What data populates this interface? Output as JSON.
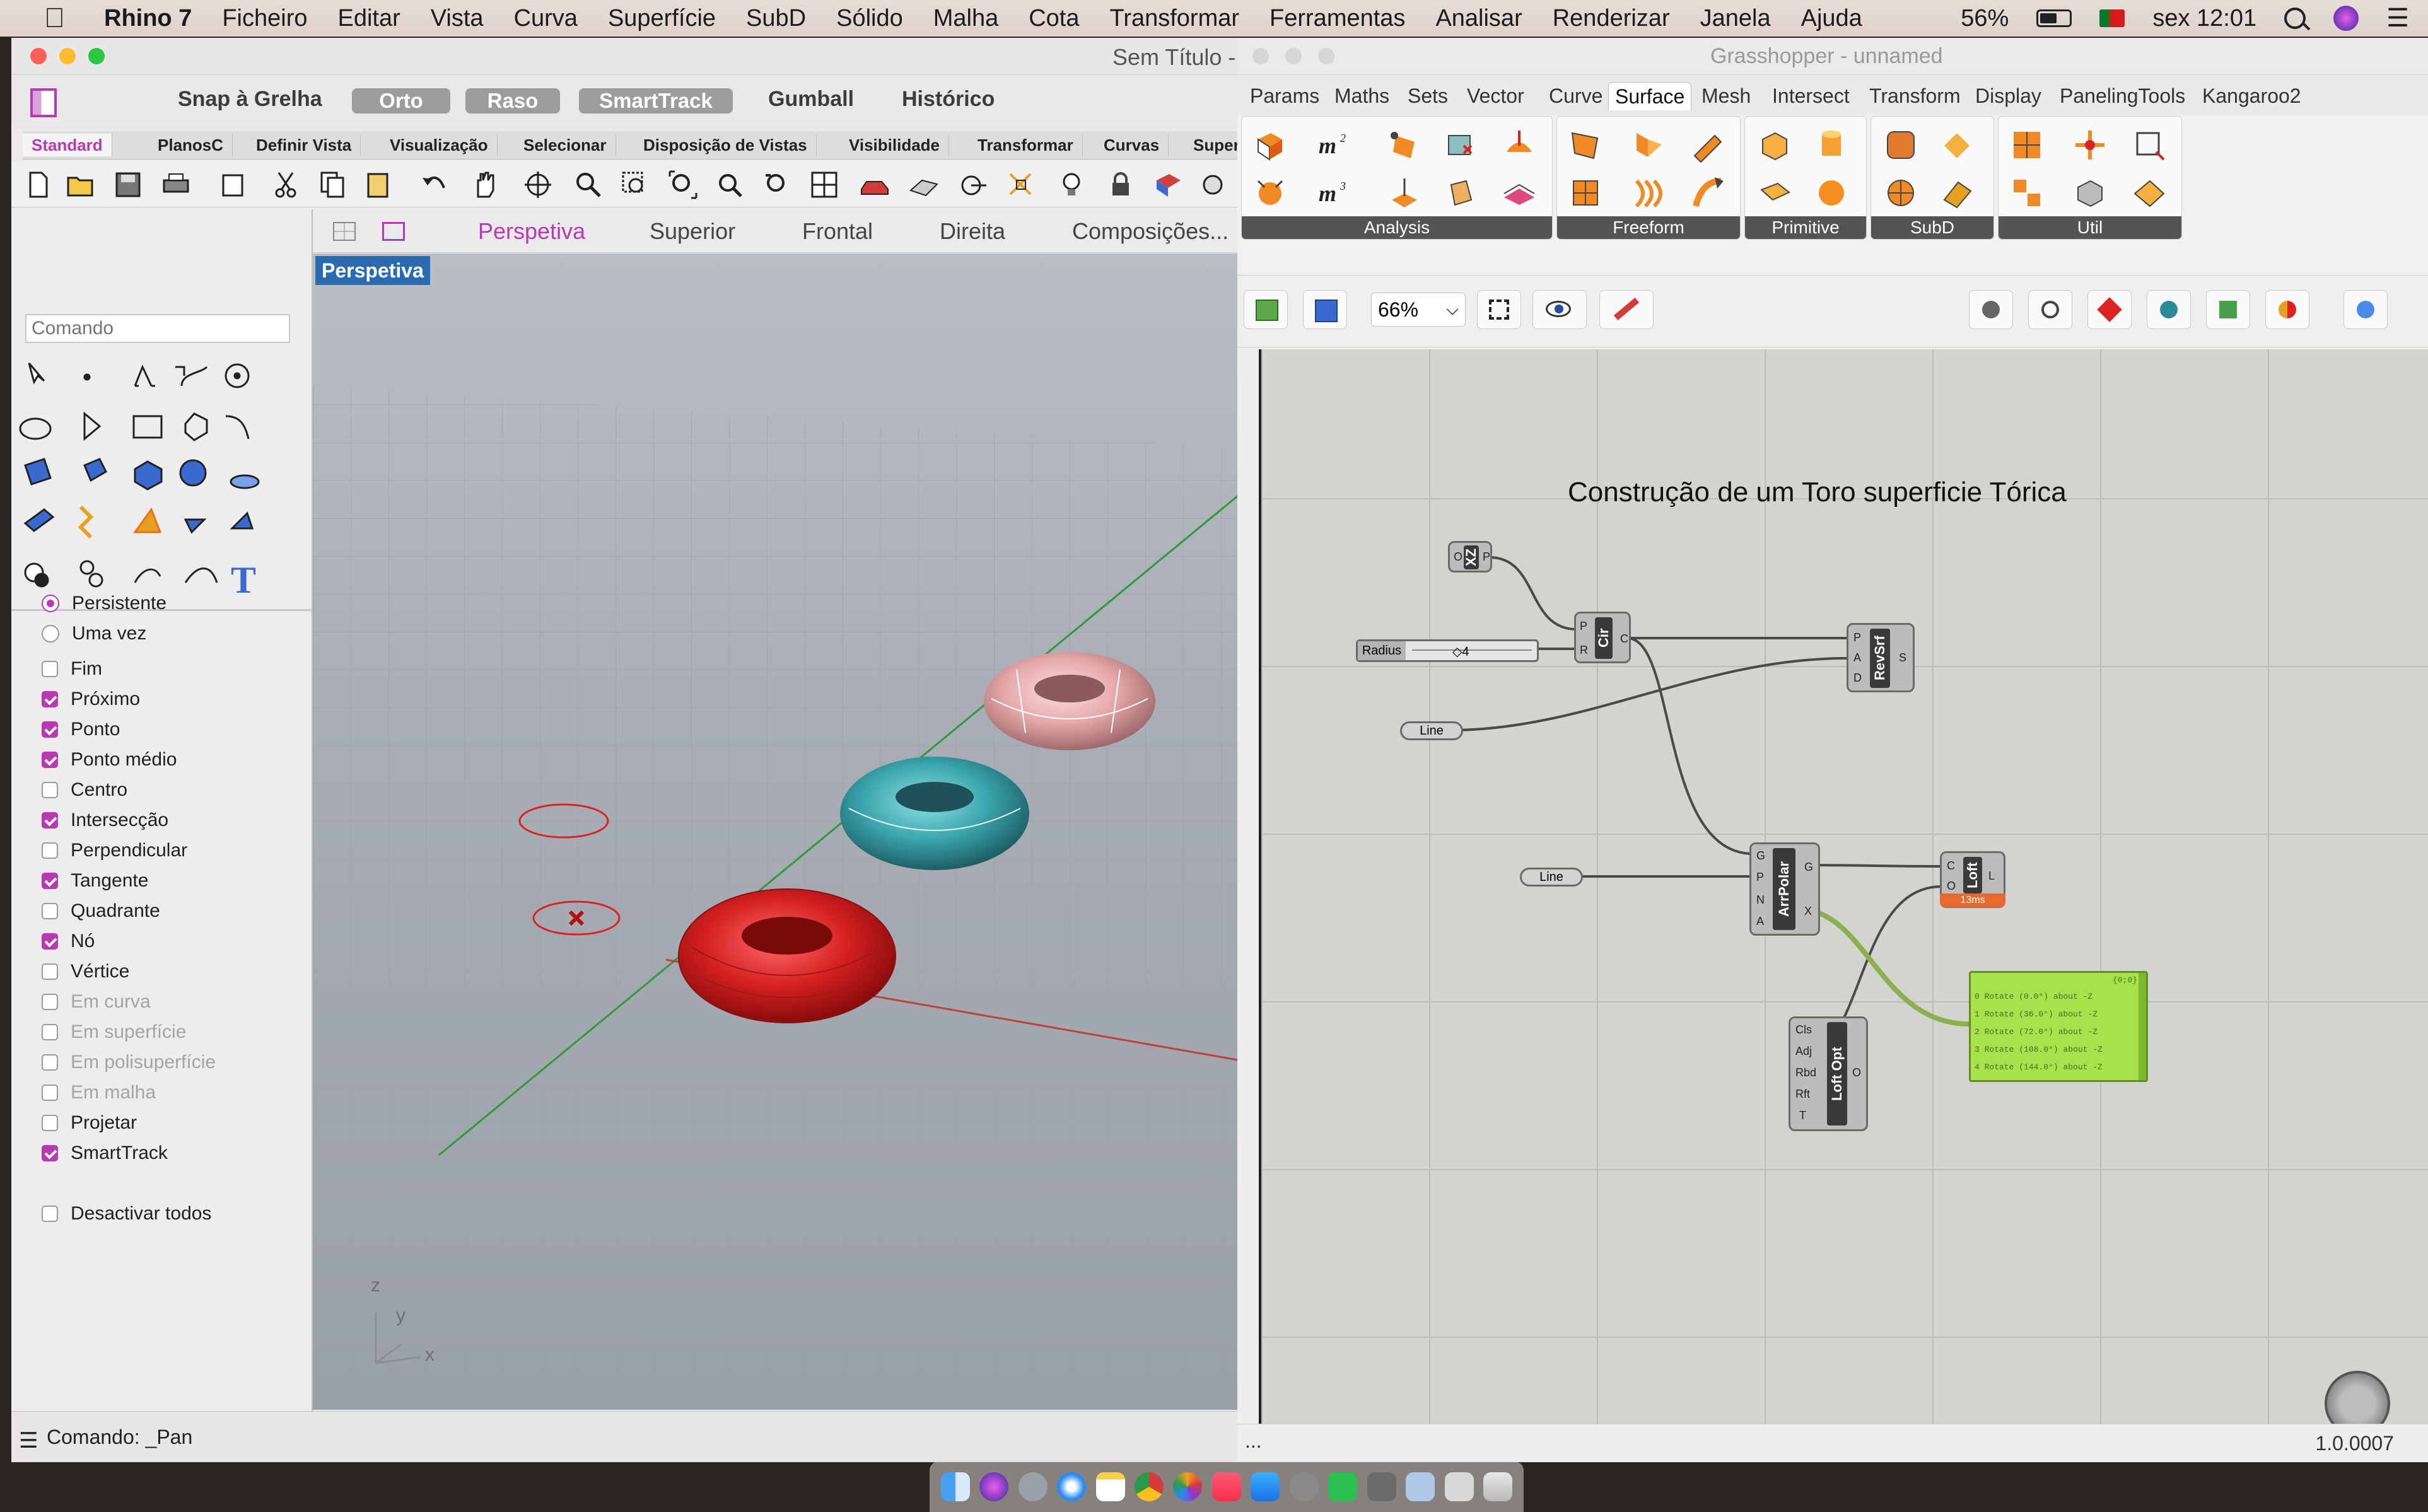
{
  "menubar": {
    "app": "Rhino 7",
    "items": [
      "Ficheiro",
      "Editar",
      "Vista",
      "Curva",
      "Superfície",
      "SubD",
      "Sólido",
      "Malha",
      "Cota",
      "Transformar",
      "Ferramentas",
      "Analisar",
      "Renderizar",
      "Janela",
      "Ajuda"
    ],
    "battery": "56%",
    "clock": "sex 12:01"
  },
  "rhino": {
    "title": "Sem Título -",
    "toolbar": {
      "snap": "Snap à Grelha",
      "ortho": "Orto",
      "planar": "Raso",
      "smarttrack": "SmartTrack",
      "gumball": "Gumball",
      "history": "Histórico"
    },
    "tabs": [
      "Standard",
      "PlanosC",
      "Definir Vista",
      "Visualização",
      "Selecionar",
      "Disposição de Vistas",
      "Visibilidade",
      "Transformar",
      "Curvas",
      "Superf"
    ],
    "command_placeholder": "Comando",
    "viewtabs": [
      "Perspetiva",
      "Superior",
      "Frontal",
      "Direita",
      "Composições..."
    ],
    "viewport_label": "Perspetiva",
    "axis": {
      "z": "z",
      "y": "y",
      "x": "x"
    },
    "osnap": [
      {
        "label": "Persistente",
        "type": "radio",
        "checked": true
      },
      {
        "label": "Uma vez",
        "type": "radio",
        "checked": false
      },
      {
        "label": "Fim",
        "checked": false
      },
      {
        "label": "Próximo",
        "checked": true
      },
      {
        "label": "Ponto",
        "checked": true
      },
      {
        "label": "Ponto médio",
        "checked": true
      },
      {
        "label": "Centro",
        "checked": false
      },
      {
        "label": "Intersecção",
        "checked": true
      },
      {
        "label": "Perpendicular",
        "checked": false
      },
      {
        "label": "Tangente",
        "checked": true
      },
      {
        "label": "Quadrante",
        "checked": false
      },
      {
        "label": "Nó",
        "checked": true
      },
      {
        "label": "Vértice",
        "checked": false
      },
      {
        "label": "Em curva",
        "checked": false,
        "disabled": true
      },
      {
        "label": "Em superfície",
        "checked": false,
        "disabled": true
      },
      {
        "label": "Em polisuperfície",
        "checked": false,
        "disabled": true
      },
      {
        "label": "Em malha",
        "checked": false,
        "disabled": true
      },
      {
        "label": "Projetar",
        "checked": false
      },
      {
        "label": "SmartTrack",
        "checked": true
      },
      {
        "label": "Desactivar todos",
        "checked": false
      }
    ],
    "status": "Comando: _Pan"
  },
  "grasshopper": {
    "title": "Grasshopper - unnamed",
    "menu": [
      "Params",
      "Maths",
      "Sets",
      "Vector",
      "Curve",
      "Surface",
      "Mesh",
      "Intersect",
      "Transform",
      "Display",
      "PanelingTools",
      "Kangaroo2"
    ],
    "active_menu": "Surface",
    "panels": [
      "Analysis",
      "Freeform",
      "Primitive",
      "SubD",
      "Util"
    ],
    "zoom": "66%",
    "canvas_title": "Construção de um Toro superficie Tórica",
    "nodes": {
      "xz": {
        "label": "XZ",
        "in": "O",
        "out": "P"
      },
      "slider": {
        "label": "Radius",
        "value": "◇4"
      },
      "circle": {
        "label": "Cir",
        "in": [
          "P",
          "R"
        ],
        "out": "C"
      },
      "line1": {
        "label": "Line"
      },
      "revsrf": {
        "label": "RevSrf",
        "in": [
          "P",
          "A",
          "D"
        ],
        "out": "S"
      },
      "line2": {
        "label": "Line"
      },
      "arrpolar": {
        "label": "ArrPolar",
        "in": [
          "G",
          "P",
          "N",
          "A"
        ],
        "out": [
          "G",
          "X"
        ]
      },
      "loft": {
        "label": "Loft",
        "in": [
          "C",
          "O"
        ],
        "out": "L",
        "time": "13ms"
      },
      "loftopt": {
        "label": "Loft Opt",
        "in": [
          "Cls",
          "Adj",
          "Rbd",
          "Rft",
          "T"
        ],
        "out": "O"
      },
      "panel": {
        "header": "{0;0}",
        "rows": [
          "0 Rotate (0.0°) about -Z",
          "1 Rotate (36.0°) about -Z",
          "2 Rotate (72.0°) about -Z",
          "3 Rotate (108.0°) about -Z",
          "4 Rotate (144.0°) about -Z"
        ]
      }
    },
    "status_left": "...",
    "version": "1.0.0007"
  },
  "colors": {
    "accent": "#b63ab0",
    "panel_green": "#a6e24a",
    "torus_red": "#d42020",
    "torus_teal": "#3aa6ad",
    "torus_pink": "#e6a8aa"
  }
}
